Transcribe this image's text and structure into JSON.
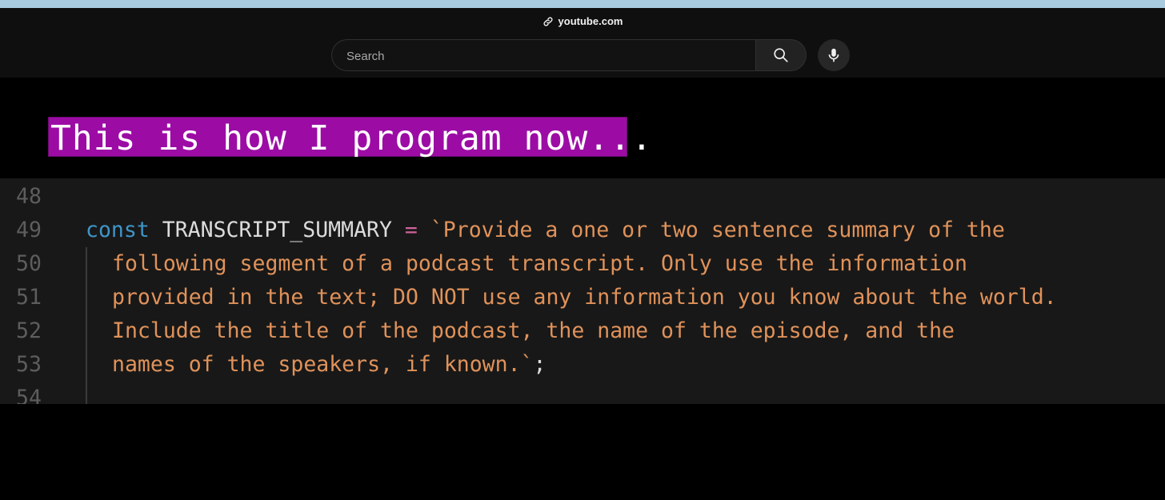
{
  "browser": {
    "url": "youtube.com",
    "link_icon": "link-icon"
  },
  "search": {
    "placeholder": "Search",
    "value": "",
    "search_icon": "search-icon",
    "mic_icon": "microphone-icon"
  },
  "video": {
    "title_overlay": "This is how I program now...",
    "colors": {
      "banner": "#9c0ca5",
      "keyword": "#3f95c8",
      "string": "#e0925a",
      "operator": "#d0629a",
      "line_number": "#5d5d5d"
    },
    "code_lines": [
      {
        "number": "48",
        "keyword": "",
        "identifier": "",
        "operator": "",
        "string": "",
        "end": ""
      },
      {
        "number": "49",
        "keyword": "const",
        "identifier": "TRANSCRIPT_SUMMARY",
        "operator": "=",
        "string": "`Provide a one or two sentence summary of the",
        "end": ""
      },
      {
        "number": "50",
        "keyword": "",
        "identifier": "",
        "operator": "",
        "string": "following segment of a podcast transcript. Only use the information",
        "end": ""
      },
      {
        "number": "51",
        "keyword": "",
        "identifier": "",
        "operator": "",
        "string": "provided in the text; DO NOT use any information you know about the world.",
        "end": ""
      },
      {
        "number": "52",
        "keyword": "",
        "identifier": "",
        "operator": "",
        "string": "Include the title of the podcast, the name of the episode, and the",
        "end": ""
      },
      {
        "number": "53",
        "keyword": "",
        "identifier": "",
        "operator": "",
        "string": "names of the speakers, if known.`",
        "end": ";"
      },
      {
        "number": "54",
        "keyword": "",
        "identifier": "",
        "operator": "",
        "string": "",
        "end": ""
      }
    ]
  }
}
